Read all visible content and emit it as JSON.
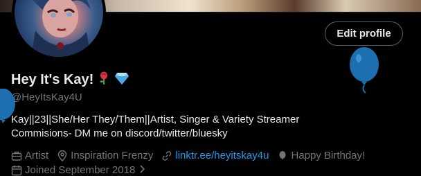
{
  "profile": {
    "display_name": "Hey It's Kay!",
    "name_emojis": [
      "rose-icon",
      "diamond-icon"
    ],
    "handle": "@HeyItsKay4U",
    "bio_lines": [
      "Kay||23||She/Her They/Them||Artist, Singer & Variety Streamer",
      "Commisions- DM me on discord/twitter/bluesky"
    ],
    "edit_button": "Edit profile"
  },
  "meta": {
    "category": "Artist",
    "location": "Inspiration Frenzy",
    "link": "linktr.ee/heyitskay4u",
    "birthday": "Happy Birthday!",
    "joined": "Joined September 2018"
  },
  "colors": {
    "background": "#000000",
    "text": "#e7e9ea",
    "muted": "#71767b",
    "link": "#1d9bf0",
    "balloon": "#1d6fb0"
  }
}
